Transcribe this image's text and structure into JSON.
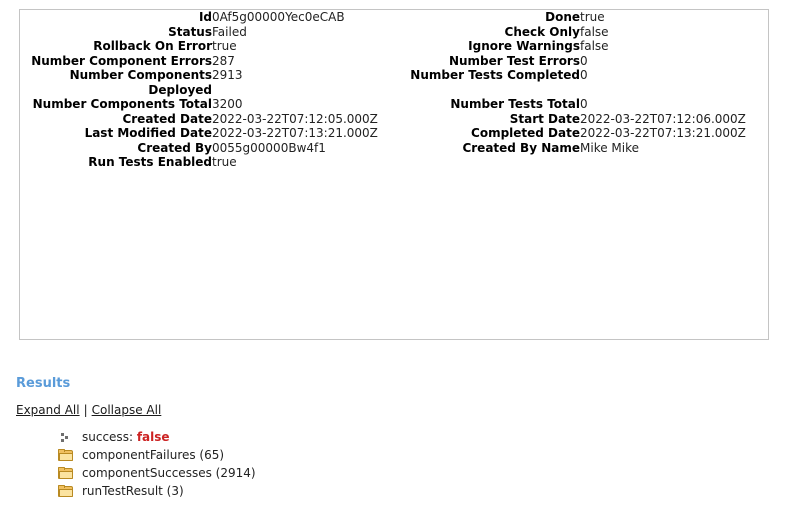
{
  "detail": {
    "rows": [
      {
        "left_label": "Id",
        "left_value": "0Af5g00000Yec0eCAB",
        "right_label": "Done",
        "right_value": "true"
      },
      {
        "left_label": "Status",
        "left_value": "Failed",
        "right_label": "Check Only",
        "right_value": "false"
      },
      {
        "left_label": "Rollback On Error",
        "left_value": "true",
        "right_label": "Ignore Warnings",
        "right_value": "false"
      },
      {
        "left_label": "Number Component Errors",
        "left_value": "287",
        "right_label": "Number Test Errors",
        "right_value": "0"
      },
      {
        "left_label": "Number Components Deployed",
        "left_value": "2913",
        "right_label": "Number Tests Completed",
        "right_value": "0"
      },
      {
        "left_label": "Number Components Total",
        "left_value": "3200",
        "right_label": "Number Tests Total",
        "right_value": "0"
      },
      {
        "left_label": "Created Date",
        "left_value": "2022-03-22T07:12:05.000Z",
        "right_label": "Start Date",
        "right_value": "2022-03-22T07:12:06.000Z"
      },
      {
        "left_label": "Last Modified Date",
        "left_value": "2022-03-22T07:13:21.000Z",
        "right_label": "Completed Date",
        "right_value": "2022-03-22T07:13:21.000Z"
      },
      {
        "left_label": "Created By",
        "left_value": "0055g00000Bw4f1",
        "right_label": "Created By Name",
        "right_value": "Mike Mike"
      },
      {
        "left_label": "Run Tests Enabled",
        "left_value": "true",
        "right_label": "",
        "right_value": ""
      }
    ]
  },
  "results": {
    "heading": "Results",
    "expand_all_label": "Expand All",
    "separator": "|",
    "collapse_all_label": "Collapse All",
    "tree": [
      {
        "icon": "leaf-node-icon",
        "key": "success:",
        "value": "false",
        "value_style": "false"
      },
      {
        "icon": "folder-icon",
        "key": "componentFailures (65)",
        "value": "",
        "value_style": "none"
      },
      {
        "icon": "folder-icon",
        "key": "componentSuccesses (2914)",
        "value": "",
        "value_style": "none"
      },
      {
        "icon": "folder-icon",
        "key": "runTestResult (3)",
        "value": "",
        "value_style": "none"
      }
    ]
  },
  "colors": {
    "heading_blue": "#5a9bd9",
    "false_red": "#cc2222",
    "folder_yellow": "#f0c060",
    "panel_border": "#c4c4c4"
  }
}
